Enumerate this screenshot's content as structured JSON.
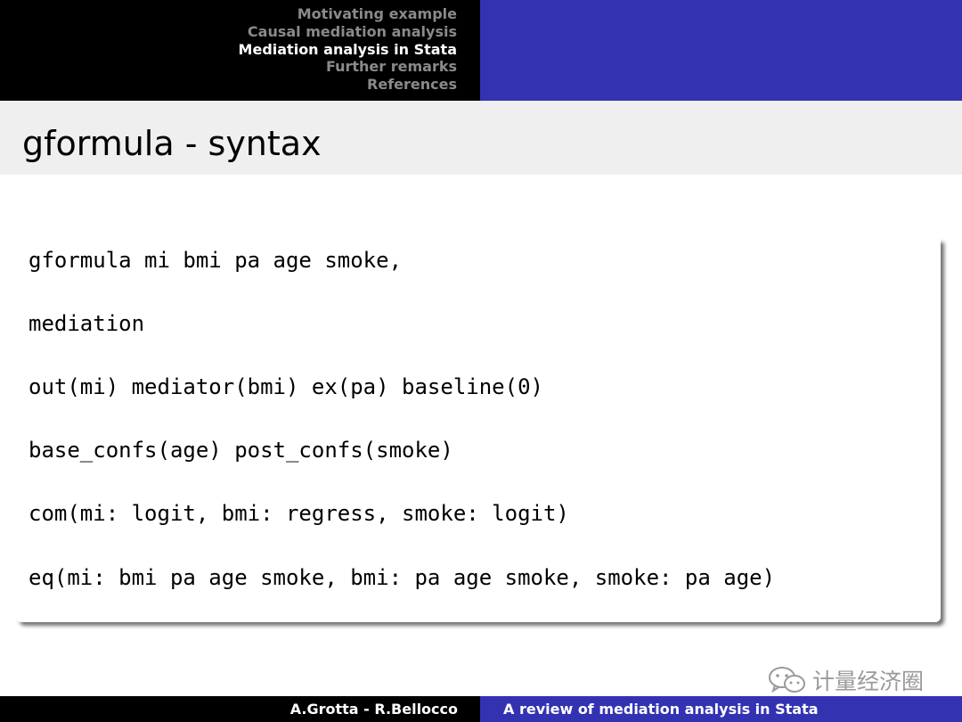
{
  "header": {
    "nav_items": [
      "Motivating example",
      "Causal mediation analysis",
      "Mediation analysis in Stata",
      "Further remarks",
      "References"
    ],
    "active_index": 2
  },
  "slide": {
    "title": "gformula - syntax",
    "code_lines": [
      "gformula mi bmi pa age smoke,",
      "mediation",
      "out(mi) mediator(bmi) ex(pa) baseline(0)",
      "base_confs(age) post_confs(smoke)",
      "com(mi: logit, bmi: regress, smoke: logit)",
      "eq(mi: bmi pa age smoke, bmi: pa age smoke, smoke: pa age)"
    ]
  },
  "watermark": {
    "icon": "wechat-icon",
    "text": "计量经济圈"
  },
  "footer": {
    "authors": "A.Grotta - R.Bellocco",
    "talk_title": "A review of mediation analysis in Stata"
  },
  "colors": {
    "header_dark": "#000000",
    "header_accent": "#3333b2",
    "inactive_nav": "#8a8a8a",
    "title_bar": "#efefef"
  }
}
